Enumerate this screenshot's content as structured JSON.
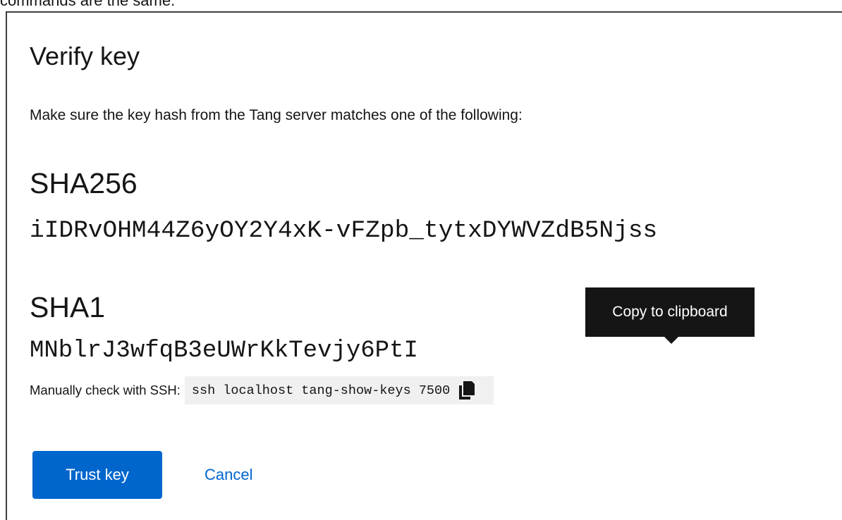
{
  "background_text": "commands are the same.",
  "dialog": {
    "title": "Verify key",
    "description": "Make sure the key hash from the Tang server matches one of the following:",
    "hashes": [
      {
        "label": "SHA256",
        "value": "iIDRvOHM44Z6yOY2Y4xK-vFZpb_tytxDYWVZdB5Njss"
      },
      {
        "label": "SHA1",
        "value": "MNblrJ3wfqB3eUWrKkTevjy6PtI"
      }
    ],
    "ssh": {
      "label": "Manually check with SSH:",
      "command": "ssh localhost tang-show-keys 7500",
      "copy_icon": "copy-icon"
    },
    "tooltip": "Copy to clipboard",
    "actions": {
      "primary": "Trust key",
      "secondary": "Cancel"
    }
  },
  "colors": {
    "primary": "#0066cc",
    "code_background": "#f0f0f0",
    "tooltip_background": "#151515",
    "text": "#151515"
  }
}
